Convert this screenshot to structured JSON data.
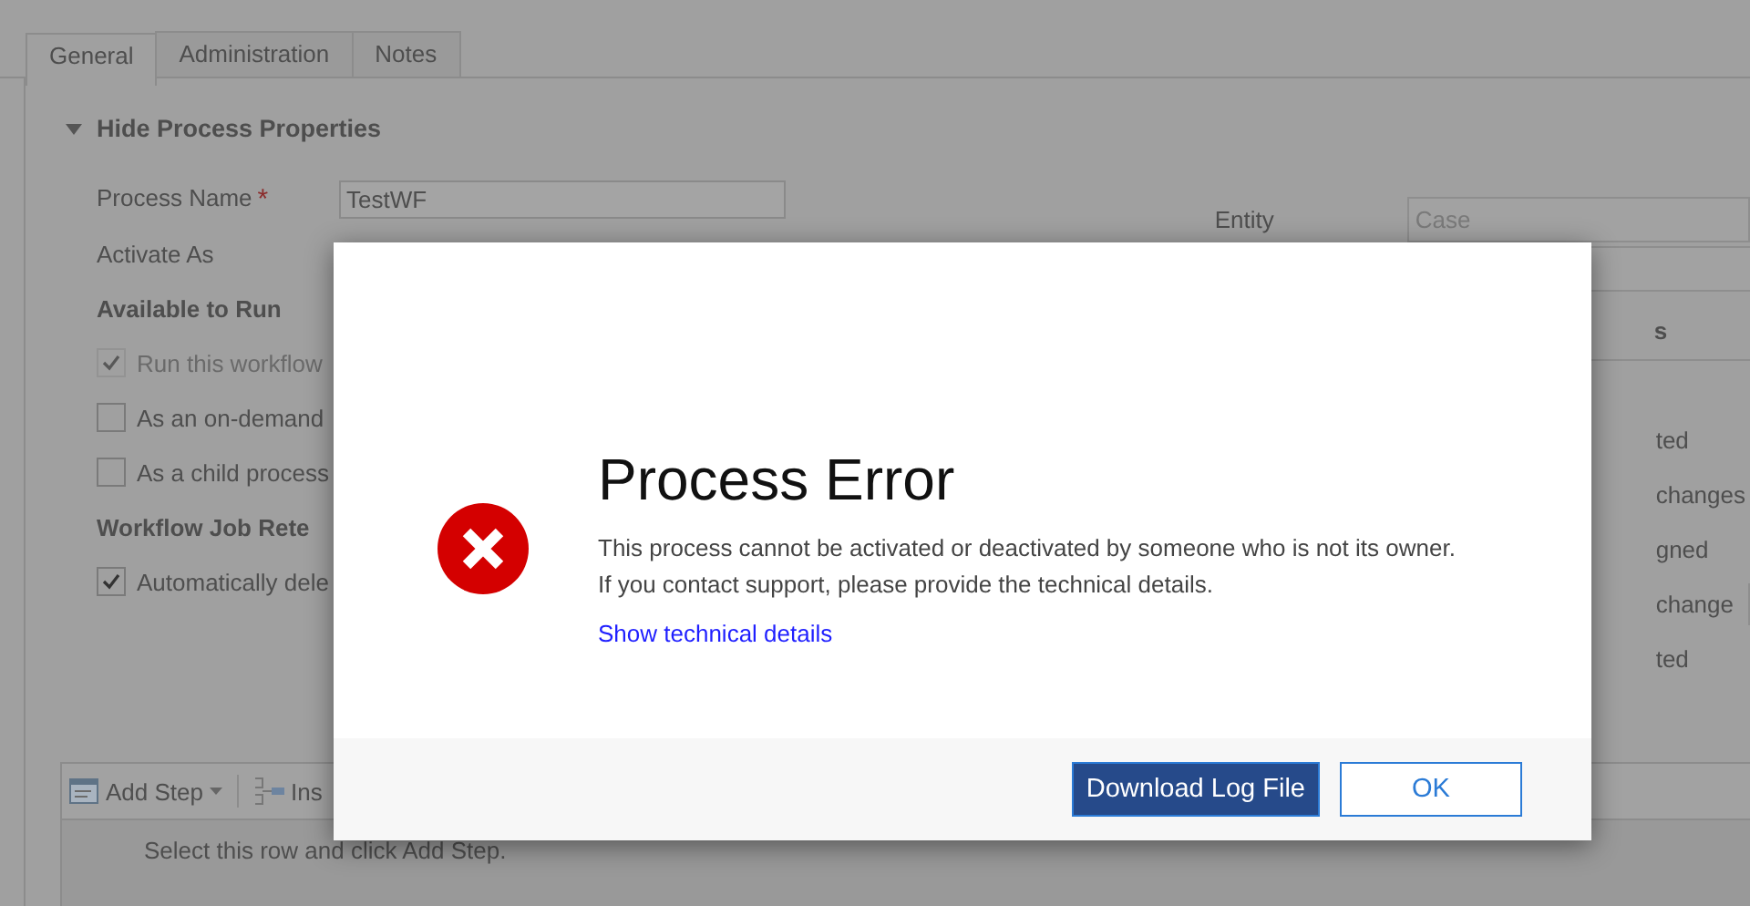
{
  "tabs": [
    {
      "label": "General",
      "selected": true
    },
    {
      "label": "Administration",
      "selected": false
    },
    {
      "label": "Notes",
      "selected": false
    }
  ],
  "section": {
    "title": "Hide Process Properties",
    "expanded": true
  },
  "fields": [
    {
      "label": "Process Name",
      "required_mark": "*",
      "value": "TestWF"
    },
    {
      "label": "Activate As"
    }
  ],
  "available_to_run": {
    "heading": "Available to Run",
    "options": [
      {
        "label": "Run this workflow",
        "checked": true,
        "disabled": true
      },
      {
        "label": "As an on-demand",
        "checked": false,
        "disabled": false
      },
      {
        "label": "As a child process",
        "checked": false,
        "disabled": false
      }
    ]
  },
  "retention": {
    "heading": "Workflow Job Rete",
    "options": [
      {
        "label": "Automatically dele",
        "checked": true,
        "disabled": false
      }
    ]
  },
  "entity": {
    "label": "Entity",
    "value": "Case"
  },
  "right_panel": {
    "heading": "s",
    "rows": [
      {
        "label": "ted",
        "kind": "text"
      },
      {
        "label": "changes",
        "kind": "text"
      },
      {
        "label": "gned",
        "kind": "text"
      },
      {
        "label": "change",
        "kind": "field"
      },
      {
        "label": "ted",
        "kind": "text"
      }
    ]
  },
  "steps_toolbar": {
    "buttons": [
      {
        "label": "Add Step",
        "kind": "dropdown"
      },
      {
        "label": "Ins",
        "kind": "insert"
      }
    ],
    "hint": "Select this row and click Add Step."
  },
  "dialog": {
    "title": "Process Error",
    "message_lines": [
      "This process cannot be activated or deactivated by someone who is not its owner.",
      "If you contact support, please provide the technical details."
    ],
    "link": "Show technical details",
    "buttons": [
      {
        "label": "Download Log File",
        "primary": true
      },
      {
        "label": "OK",
        "primary": false
      }
    ]
  }
}
